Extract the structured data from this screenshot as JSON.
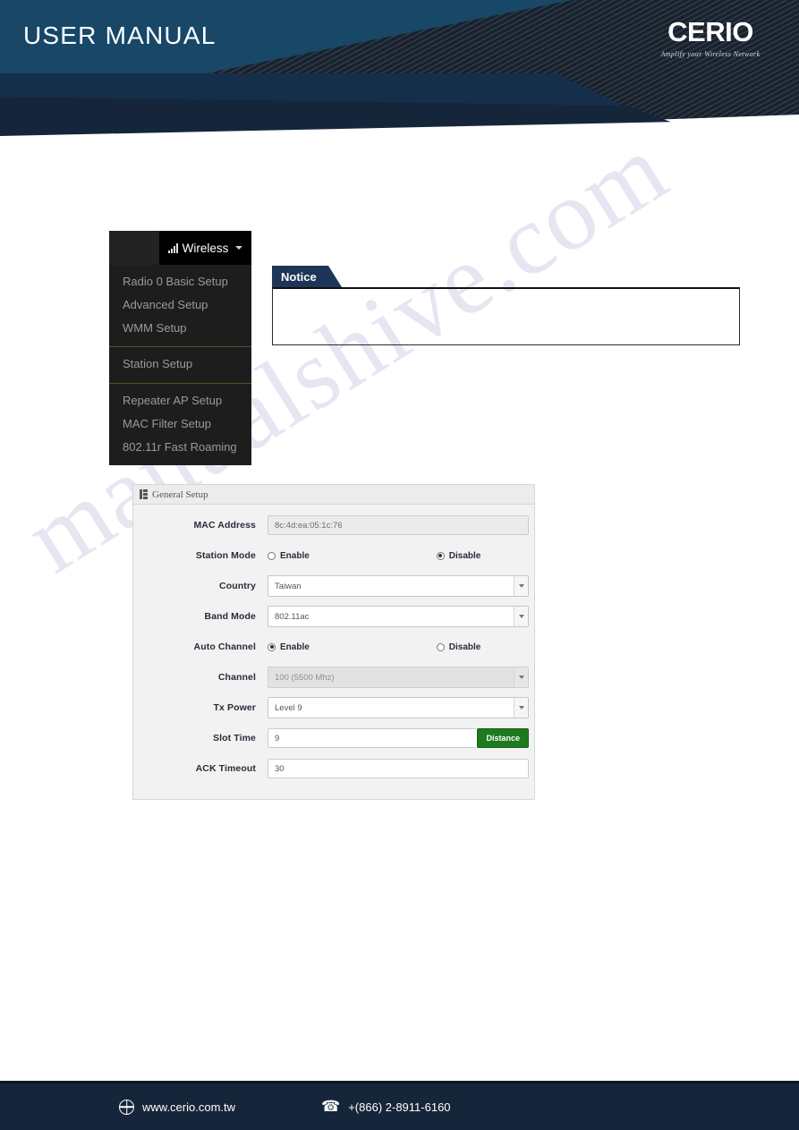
{
  "header": {
    "title": "USER MANUAL",
    "logo_mark": "CERIO",
    "logo_tagline": "Amplify your Wireless Network"
  },
  "watermark": {
    "text": "manualshive.com"
  },
  "nav": {
    "tab_label": "Wireless",
    "tab_icon": "signal-bars-icon",
    "caret_icon": "chevron-down-icon",
    "groups": [
      {
        "items": [
          {
            "label": "Radio 0 Basic Setup"
          },
          {
            "label": "Advanced Setup"
          },
          {
            "label": "WMM Setup"
          }
        ]
      },
      {
        "items": [
          {
            "label": "Station Setup"
          }
        ]
      },
      {
        "items": [
          {
            "label": "Repeater AP Setup"
          },
          {
            "label": "MAC Filter Setup"
          },
          {
            "label": "802.11r Fast Roaming"
          }
        ]
      }
    ]
  },
  "notice": {
    "tab_label": "Notice",
    "body_text": ""
  },
  "panel": {
    "header_label": "General Setup",
    "header_icon": "list-grid-icon",
    "fields": [
      {
        "label": "MAC Address",
        "type": "text_readonly",
        "value": "8c:4d:ea:05:1c:76"
      },
      {
        "label": "Station Mode",
        "type": "radio",
        "options": [
          {
            "label": "Enable",
            "selected": false
          },
          {
            "label": "Disable",
            "selected": true
          }
        ]
      },
      {
        "label": "Country",
        "type": "select",
        "value": "Taiwan",
        "disabled": false
      },
      {
        "label": "Band Mode",
        "type": "select",
        "value": "802.11ac",
        "disabled": false
      },
      {
        "label": "Auto Channel",
        "type": "radio",
        "options": [
          {
            "label": "Enable",
            "selected": true
          },
          {
            "label": "Disable",
            "selected": false
          }
        ]
      },
      {
        "label": "Channel",
        "type": "select",
        "value": "100 (5500 Mhz)",
        "disabled": true
      },
      {
        "label": "Tx Power",
        "type": "select",
        "value": "Level 9",
        "disabled": false
      },
      {
        "label": "Slot Time",
        "type": "text_button",
        "value": "9",
        "button_label": "Distance"
      },
      {
        "label": "ACK Timeout",
        "type": "text",
        "value": "30"
      }
    ]
  },
  "footer": {
    "website": "www.cerio.com.tw",
    "website_icon": "globe-icon",
    "phone": "+(866) 2-8911-6160",
    "phone_icon": "phone-icon"
  },
  "colors": {
    "header_navy": "#16263a",
    "header_blue": "#184767",
    "notice_navy": "#1d3557",
    "button_green": "#1d7a1d",
    "menu_black": "#1b1b1b",
    "menu_divider_green": "#3b5e2b"
  }
}
